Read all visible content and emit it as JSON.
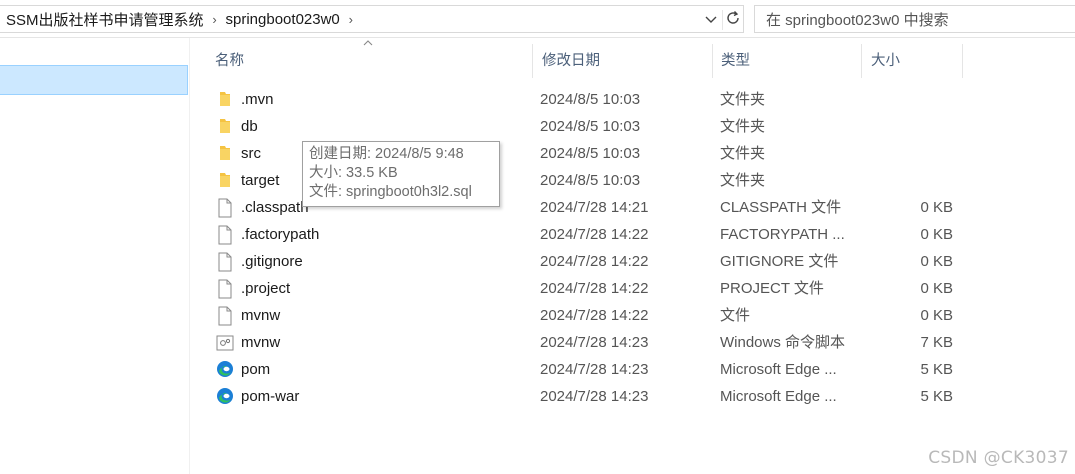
{
  "address_bar": {
    "breadcrumbs": [
      "SSM出版社样书申请管理系统",
      "springboot023w0"
    ],
    "separator": "›",
    "dropdown_icon": "chevron-down-icon",
    "refresh_icon": "refresh-icon"
  },
  "search": {
    "placeholder": "在 springboot023w0 中搜索"
  },
  "columns": {
    "name": "名称",
    "date": "修改日期",
    "type": "类型",
    "size": "大小"
  },
  "files": [
    {
      "name": ".mvn",
      "date": "2024/8/5 10:03",
      "type": "文件夹",
      "size": "",
      "icon": "folder-icon"
    },
    {
      "name": "db",
      "date": "2024/8/5 10:03",
      "type": "文件夹",
      "size": "",
      "icon": "folder-icon"
    },
    {
      "name": "src",
      "date": "2024/8/5 10:03",
      "type": "文件夹",
      "size": "",
      "icon": "folder-icon"
    },
    {
      "name": "target",
      "date": "2024/8/5 10:03",
      "type": "文件夹",
      "size": "",
      "icon": "folder-icon"
    },
    {
      "name": ".classpath",
      "date": "2024/7/28 14:21",
      "type": "CLASSPATH 文件",
      "size": "0 KB",
      "icon": "file-icon"
    },
    {
      "name": ".factorypath",
      "date": "2024/7/28 14:22",
      "type": "FACTORYPATH ...",
      "size": "0 KB",
      "icon": "file-icon"
    },
    {
      "name": ".gitignore",
      "date": "2024/7/28 14:22",
      "type": "GITIGNORE 文件",
      "size": "0 KB",
      "icon": "file-icon"
    },
    {
      "name": ".project",
      "date": "2024/7/28 14:22",
      "type": "PROJECT 文件",
      "size": "0 KB",
      "icon": "file-icon"
    },
    {
      "name": "mvnw",
      "date": "2024/7/28 14:22",
      "type": "文件",
      "size": "0 KB",
      "icon": "file-icon"
    },
    {
      "name": "mvnw",
      "date": "2024/7/28 14:23",
      "type": "Windows 命令脚本",
      "size": "7 KB",
      "icon": "script-icon"
    },
    {
      "name": "pom",
      "date": "2024/7/28 14:23",
      "type": "Microsoft Edge ...",
      "size": "5 KB",
      "icon": "edge-icon"
    },
    {
      "name": "pom-war",
      "date": "2024/7/28 14:23",
      "type": "Microsoft Edge ...",
      "size": "5 KB",
      "icon": "edge-icon"
    }
  ],
  "tooltip": {
    "created": "创建日期: 2024/8/5 9:48",
    "size": "大小: 33.5 KB",
    "files": "文件: springboot0h3l2.sql"
  },
  "watermark": "CSDN @CK3037",
  "colors": {
    "folder": "#f5c342",
    "selection": "#cce8ff",
    "edge_blue": "#1b7fd6",
    "edge_green": "#2fc15f"
  }
}
